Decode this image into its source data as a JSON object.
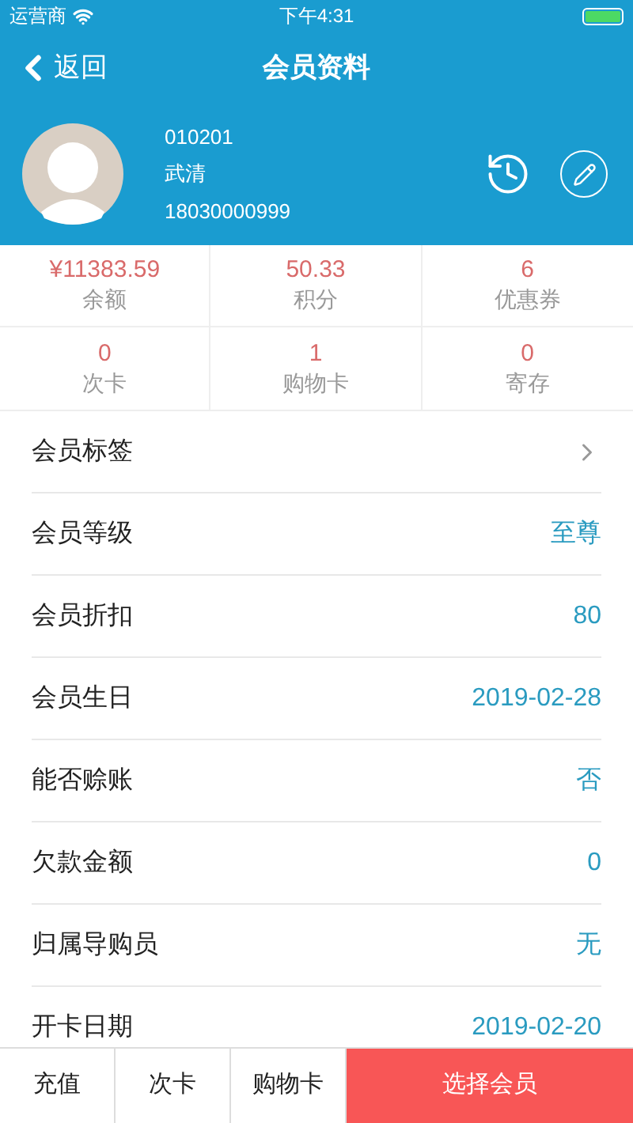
{
  "status_bar": {
    "carrier": "运营商",
    "time": "下午4:31"
  },
  "nav": {
    "back": "返回",
    "title": "会员资料"
  },
  "member": {
    "code": "010201",
    "name": "武清",
    "phone": "18030000999"
  },
  "stats": [
    {
      "value": "¥11383.59",
      "label": "余额"
    },
    {
      "value": "50.33",
      "label": "积分"
    },
    {
      "value": "6",
      "label": "优惠券"
    },
    {
      "value": "0",
      "label": "次卡"
    },
    {
      "value": "1",
      "label": "购物卡"
    },
    {
      "value": "0",
      "label": "寄存"
    }
  ],
  "fields": [
    {
      "kind": "link",
      "label": "会员标签"
    },
    {
      "kind": "value",
      "label": "会员等级",
      "value": "至尊"
    },
    {
      "kind": "value",
      "label": "会员折扣",
      "value": "80"
    },
    {
      "kind": "value",
      "label": "会员生日",
      "value": "2019-02-28"
    },
    {
      "kind": "value",
      "label": "能否赊账",
      "value": "否"
    },
    {
      "kind": "value",
      "label": "欠款金额",
      "value": "0"
    },
    {
      "kind": "value",
      "label": "归属导购员",
      "value": "无"
    },
    {
      "kind": "value",
      "label": "开卡日期",
      "value": "2019-02-20"
    }
  ],
  "actions": [
    {
      "label": "充值",
      "primary": false
    },
    {
      "label": "次卡",
      "primary": false
    },
    {
      "label": "购物卡",
      "primary": false
    },
    {
      "label": "选择会员",
      "primary": true
    }
  ]
}
